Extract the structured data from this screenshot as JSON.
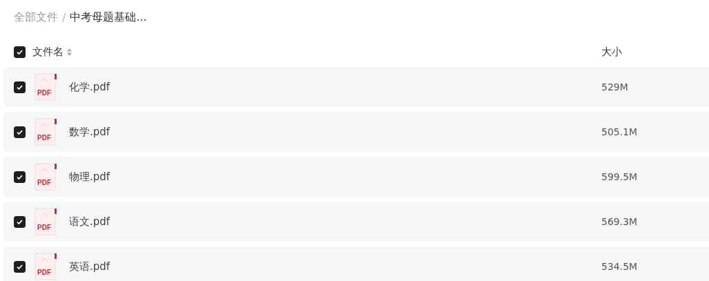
{
  "breadcrumb": {
    "separator": "/",
    "items": [
      {
        "label": "全部文件",
        "current": false
      },
      {
        "label": "中考母题基础...",
        "current": true
      }
    ]
  },
  "table": {
    "select_all": {
      "checked": true
    },
    "columns": [
      "文件名",
      "大小"
    ],
    "rows": [
      {
        "name": "化学.pdf",
        "size": "529M",
        "icon_text": "PDF",
        "checked": true
      },
      {
        "name": "数学.pdf",
        "size": "505.1M",
        "icon_text": "PDF",
        "checked": true
      },
      {
        "name": "物理.pdf",
        "size": "599.5M",
        "icon_text": "PDF",
        "checked": true
      },
      {
        "name": "语文.pdf",
        "size": "569.3M",
        "icon_text": "PDF",
        "checked": true
      },
      {
        "name": "英语.pdf",
        "size": "534.5M",
        "icon_text": "PDF",
        "checked": true
      }
    ]
  }
}
